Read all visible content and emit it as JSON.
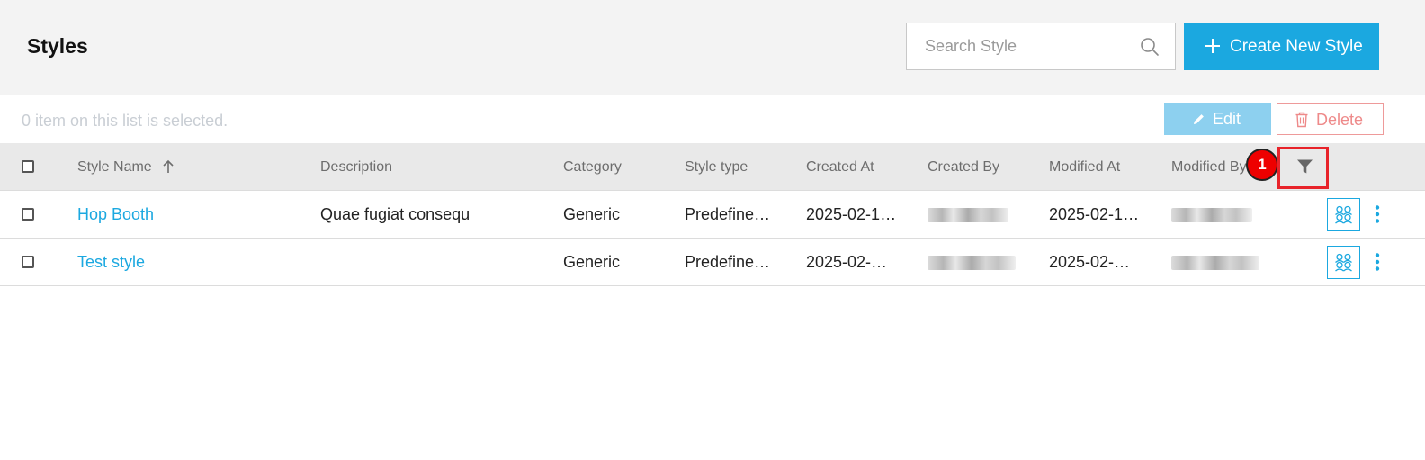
{
  "header": {
    "title": "Styles",
    "search": {
      "placeholder": "Search Style",
      "value": ""
    },
    "create_button": "Create New Style"
  },
  "selection_bar": {
    "text": "0 item on this list is selected.",
    "edit_label": "Edit",
    "delete_label": "Delete"
  },
  "table": {
    "columns": [
      "Style Name",
      "Description",
      "Category",
      "Style type",
      "Created At",
      "Created By",
      "Modified At",
      "Modified By"
    ],
    "sort_column": "Style Name",
    "sort_direction": "ascending",
    "rows": [
      {
        "name": "Hop Booth",
        "description": "Quae fugiat consequ",
        "category": "Generic",
        "style_type": "Predefine…",
        "created_at": "2025-02-1…",
        "modified_at": "2025-02-1…"
      },
      {
        "name": "Test style",
        "description": "",
        "category": "Generic",
        "style_type": "Predefine…",
        "created_at": "2025-02-…",
        "modified_at": "2025-02-…"
      }
    ]
  },
  "annotation": {
    "badge": "1"
  },
  "colors": {
    "accent": "#1ba8e0",
    "edit_bg": "#8dd0ef",
    "delete": "#ee8a8a",
    "highlight": "#e8232a"
  },
  "icons": [
    "search-icon",
    "plus-icon",
    "pencil-icon",
    "trash-icon",
    "arrow-up-icon",
    "filter-icon",
    "users-icon",
    "kebab-icon"
  ]
}
